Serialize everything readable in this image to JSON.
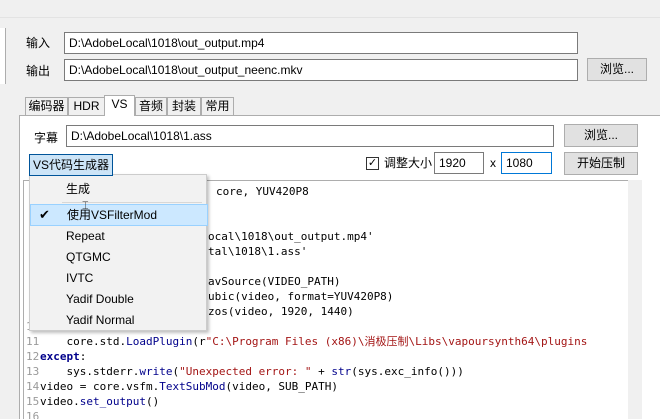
{
  "io": {
    "input_label": "输入",
    "input_value": "D:\\AdobeLocal\\1018\\out_output.mp4",
    "output_label": "输出",
    "output_value": "D:\\AdobeLocal\\1018\\out_output_neenc.mkv",
    "browse_label": "浏览..."
  },
  "tabs": [
    "编码器",
    "HDR",
    "VS",
    "音频",
    "封装",
    "常用"
  ],
  "active_tab": "VS",
  "vs": {
    "subtitle_label": "字幕",
    "subtitle_value": "D:\\AdobeLocal\\1018\\1.ass",
    "browse_label": "浏览...",
    "generator_button": "VS代码生成器",
    "resize_label": "调整大小",
    "resize_checked": true,
    "width": "1920",
    "x_label": "x",
    "height": "1080",
    "start_button": "开始压制"
  },
  "menu": {
    "items": [
      {
        "label": "生成",
        "checked": false
      },
      {
        "label": "使用VSFilterMod",
        "checked": true
      },
      {
        "label": "Repeat",
        "checked": false
      },
      {
        "label": "QTGMC",
        "checked": false
      },
      {
        "label": "IVTC",
        "checked": false
      },
      {
        "label": "Yadif Double",
        "checked": false
      },
      {
        "label": "Yadif Normal",
        "checked": false
      }
    ]
  },
  "code": {
    "partial_lines": [
      {
        "text": "core, YUV420P8"
      },
      {
        "text": "ocal\\1018\\out_output.mp4'"
      },
      {
        "text": "tal\\1018\\1.ass'"
      },
      {
        "text": "avSource(VIDEO_PATH)"
      },
      {
        "text": "ubic(video, format=YUV420P8)"
      },
      {
        "text": "zos(video, 1920, 1440)"
      }
    ],
    "line_numbers": [
      "1",
      "11",
      "12",
      "13",
      "14",
      "15",
      "16"
    ],
    "line11": {
      "pre": "    core.std.",
      "fn": "LoadPlugin",
      "post": "(r",
      "str": "\"C:\\Program Files (x86)\\消极压制\\Libs\\vapoursynth64\\plugins"
    },
    "line12": "except",
    "line12_colon": ":",
    "line13": {
      "pre": "    sys.stderr.",
      "fn": "write",
      "post1": "(",
      "str": "\"Unexpected error: \"",
      "post2": " + ",
      "fn2": "str",
      "post3": "(sys.exc_info()))"
    },
    "line14": {
      "pre": "video = core.vsfm.",
      "fn": "TextSubMod",
      "post": "(video, SUB_PATH)"
    },
    "line15": {
      "pre": "video.",
      "fn": "set_output",
      "post": "()"
    }
  }
}
